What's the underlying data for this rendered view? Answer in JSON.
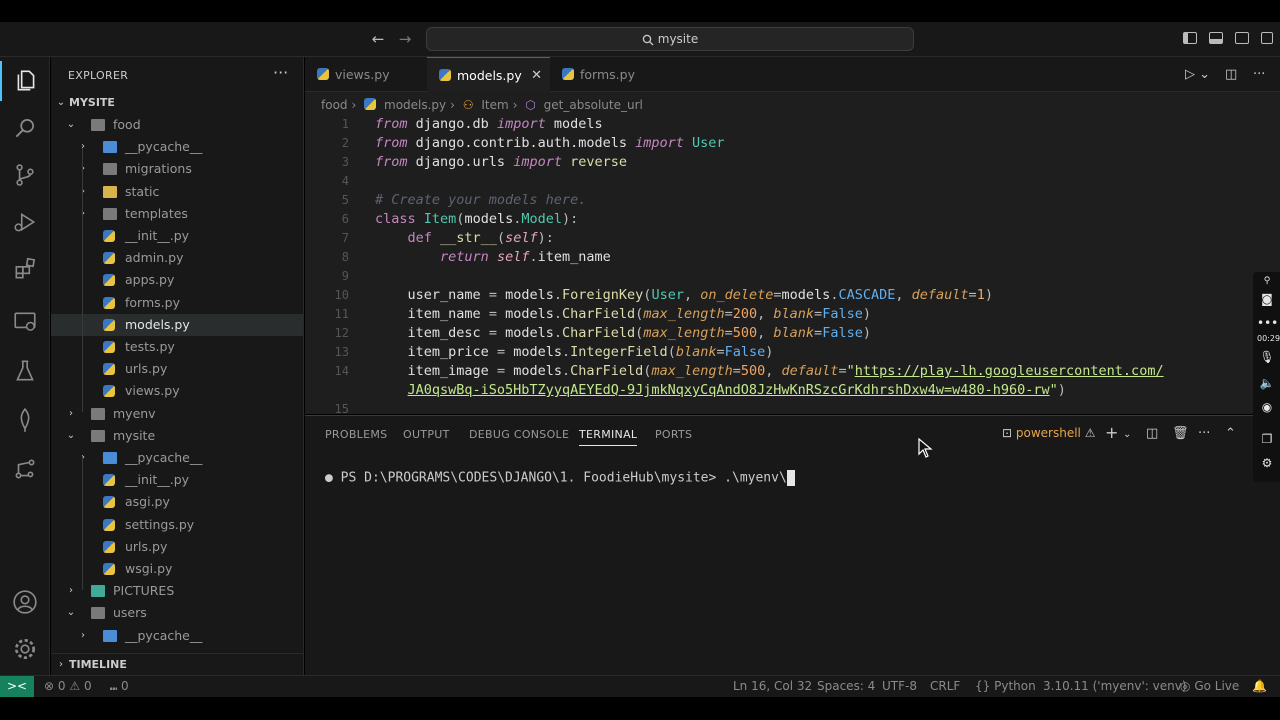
{
  "titlebar": {
    "back_icon": "arrow-left-icon",
    "forward_icon": "arrow-right-icon",
    "command_center": "mysite"
  },
  "sidebar": {
    "title": "EXPLORER",
    "more": "···",
    "root": "MYSITE",
    "tree": [
      {
        "label": "food",
        "type": "folder-open",
        "depth": 1
      },
      {
        "label": "__pycache__",
        "type": "folder-blue",
        "depth": 2
      },
      {
        "label": "migrations",
        "type": "folder",
        "depth": 2
      },
      {
        "label": "static",
        "type": "folder-yellow",
        "depth": 2
      },
      {
        "label": "templates",
        "type": "folder",
        "depth": 2
      },
      {
        "label": "__init__.py",
        "type": "py",
        "depth": 2
      },
      {
        "label": "admin.py",
        "type": "py",
        "depth": 2
      },
      {
        "label": "apps.py",
        "type": "py",
        "depth": 2
      },
      {
        "label": "forms.py",
        "type": "py",
        "depth": 2
      },
      {
        "label": "models.py",
        "type": "py",
        "depth": 2,
        "selected": true
      },
      {
        "label": "tests.py",
        "type": "py",
        "depth": 2
      },
      {
        "label": "urls.py",
        "type": "py",
        "depth": 2
      },
      {
        "label": "views.py",
        "type": "py",
        "depth": 2
      },
      {
        "label": "myenv",
        "type": "folder",
        "depth": 1
      },
      {
        "label": "mysite",
        "type": "folder-open",
        "depth": 1
      },
      {
        "label": "__pycache__",
        "type": "folder-blue",
        "depth": 2
      },
      {
        "label": "__init__.py",
        "type": "py",
        "depth": 2
      },
      {
        "label": "asgi.py",
        "type": "py",
        "depth": 2
      },
      {
        "label": "settings.py",
        "type": "py",
        "depth": 2
      },
      {
        "label": "urls.py",
        "type": "py",
        "depth": 2
      },
      {
        "label": "wsgi.py",
        "type": "py",
        "depth": 2
      },
      {
        "label": "PICTURES",
        "type": "folder-teal",
        "depth": 1
      },
      {
        "label": "users",
        "type": "folder-open",
        "depth": 1
      },
      {
        "label": "__pycache__",
        "type": "folder-blue",
        "depth": 2
      }
    ],
    "timeline": "TIMELINE"
  },
  "editor": {
    "tabs": [
      {
        "label": "views.py",
        "active": false
      },
      {
        "label": "models.py",
        "active": true
      },
      {
        "label": "forms.py",
        "active": false
      }
    ],
    "close_glyph": "✕",
    "breadcrumb": [
      "food",
      "models.py",
      "Item",
      "get_absolute_url"
    ],
    "line_numbers": [
      "1",
      "2",
      "3",
      "4",
      "5",
      "6",
      "7",
      "8",
      "9",
      "10",
      "11",
      "12",
      "13",
      "14",
      "",
      "15"
    ]
  },
  "panel": {
    "tabs": [
      "PROBLEMS",
      "OUTPUT",
      "DEBUG CONSOLE",
      "TERMINAL",
      "PORTS"
    ],
    "active_tab": "TERMINAL",
    "shell": "powershell",
    "terminal_prompt": "PS D:\\PROGRAMS\\CODES\\DJANGO\\1. FoodieHub\\mysite> ",
    "terminal_input": ".\\myenv\\"
  },
  "overlay": {
    "time": "00:29"
  },
  "statusbar": {
    "remote": "><",
    "errors": "0",
    "warnings": "0",
    "ports": "0",
    "position": "Ln 16, Col 32",
    "spaces": "Spaces: 4",
    "encoding": "UTF-8",
    "eol": "CRLF",
    "language": "Python",
    "interpreter": "3.10.11 ('myenv': venv)",
    "golive": "Go Live"
  },
  "colors": {
    "accent": "#0078d4",
    "remote_bg": "#16825d",
    "editor_bg": "#1e1e1e",
    "chrome_bg": "#181818"
  }
}
